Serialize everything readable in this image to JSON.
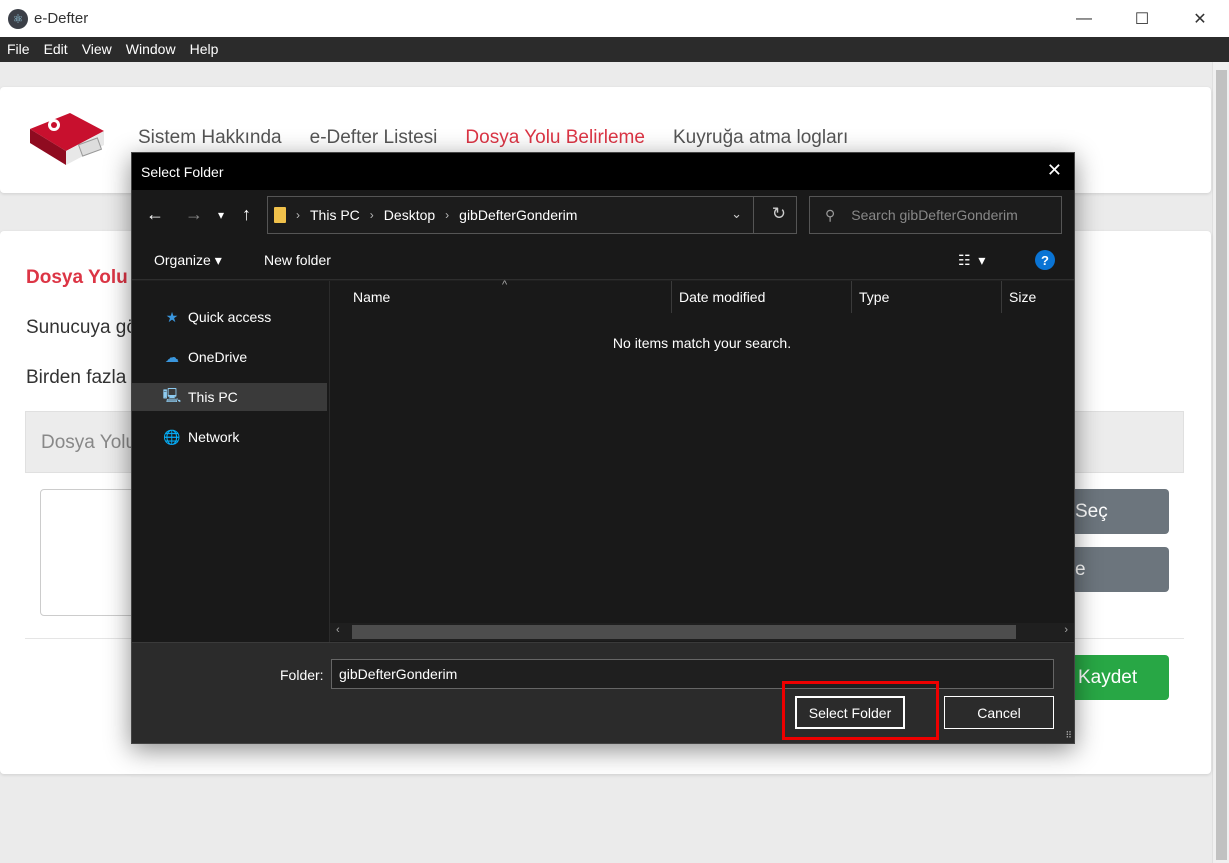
{
  "window": {
    "title": "e-Defter"
  },
  "menu": [
    "File",
    "Edit",
    "View",
    "Window",
    "Help"
  ],
  "nav": {
    "items": [
      "Sistem Hakkında",
      "e-Defter Listesi",
      "Dosya Yolu Belirleme",
      "Kuyruğa atma logları"
    ],
    "active_index": 2
  },
  "page": {
    "section_title": "Dosya Yolu",
    "para1": "Sunucuya gö",
    "para2": "Birden fazla",
    "band_label": "Dosya Yolu",
    "btn_select": "Seç",
    "btn_second": "e",
    "btn_save": "Kaydet"
  },
  "dialog": {
    "title": "Select Folder",
    "breadcrumb": [
      "This PC",
      "Desktop",
      "gibDefterGonderim"
    ],
    "search_placeholder": "Search gibDefterGonderim",
    "organize": "Organize",
    "new_folder": "New folder",
    "help": "?",
    "sidebar": [
      {
        "label": "Quick access",
        "icon": "star-icon"
      },
      {
        "label": "OneDrive",
        "icon": "cloud-icon"
      },
      {
        "label": "This PC",
        "icon": "computer-icon",
        "selected": true
      },
      {
        "label": "Network",
        "icon": "network-icon"
      }
    ],
    "columns": [
      "Name",
      "Date modified",
      "Type",
      "Size"
    ],
    "empty_message": "No items match your search.",
    "folder_label": "Folder:",
    "folder_value": "gibDefterGonderim",
    "select_button": "Select Folder",
    "cancel_button": "Cancel"
  },
  "colors": {
    "accent_red": "#dc3545",
    "save_green": "#28a745",
    "secondary_grey": "#6c757d",
    "dialog_bg": "#202020"
  }
}
